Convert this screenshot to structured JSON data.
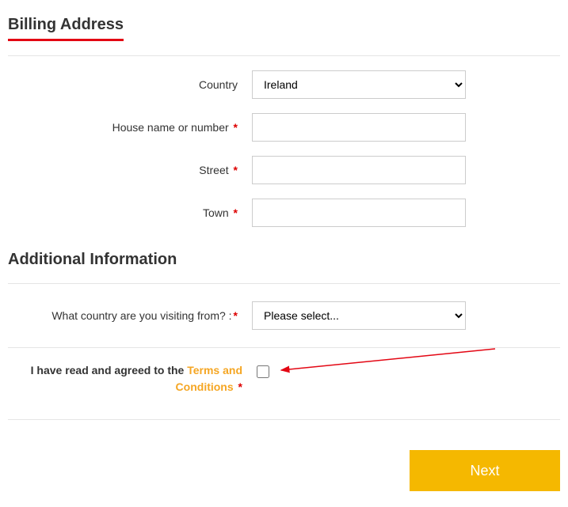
{
  "billing": {
    "title": "Billing Address",
    "fields": {
      "country": {
        "label": "Country",
        "value": "Ireland"
      },
      "house": {
        "label": "House name or number"
      },
      "street": {
        "label": "Street"
      },
      "town": {
        "label": "Town"
      }
    }
  },
  "additional": {
    "title": "Additional Information",
    "visiting": {
      "label": "What country are you visiting from? :",
      "placeholder": "Please select..."
    }
  },
  "terms": {
    "prefix": "I have read and agreed to the ",
    "link_text": "Terms and Conditions"
  },
  "required_mark": "*",
  "buttons": {
    "next": "Next"
  }
}
